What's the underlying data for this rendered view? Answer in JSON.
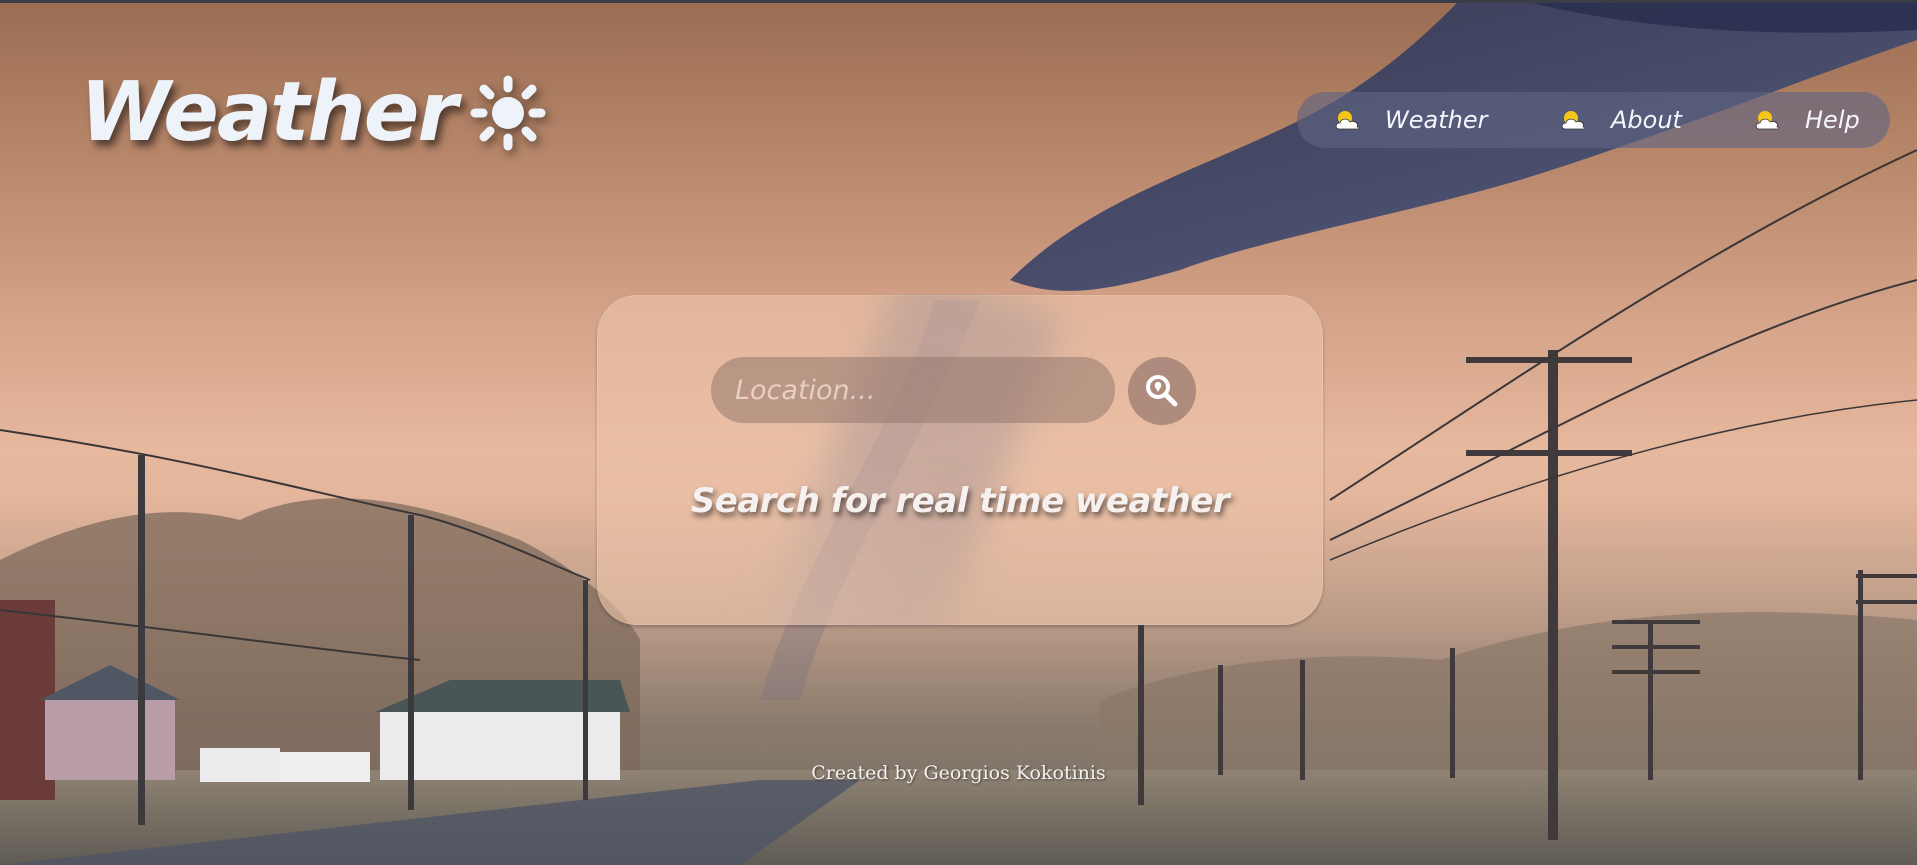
{
  "brand": {
    "title": "Weather",
    "icon": "sun-icon"
  },
  "nav": {
    "items": [
      {
        "label": "Weather",
        "icon": "cloud-sun-icon"
      },
      {
        "label": "About",
        "icon": "cloud-sun-icon"
      },
      {
        "label": "Help",
        "icon": "cloud-sun-icon"
      }
    ]
  },
  "search": {
    "placeholder": "Location...",
    "value": "",
    "button_icon": "location-search-icon",
    "heading": "Search for real time weather"
  },
  "footer": {
    "credit": "Created by Georgios Kokotinis"
  },
  "colors": {
    "text_light": "#eef3fa",
    "nav_background": "#5f6482",
    "card_background": "#ecc4aa"
  }
}
